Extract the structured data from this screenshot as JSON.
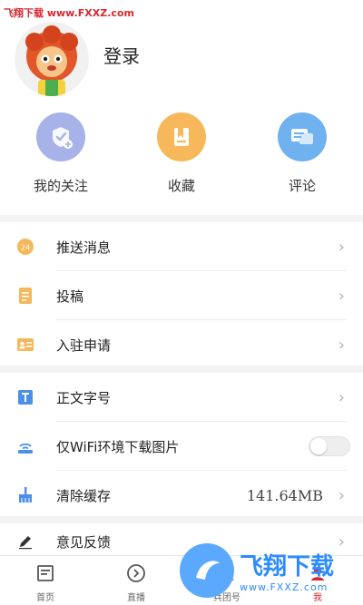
{
  "watermark_top": "飞翔下载 www.FXXZ.com",
  "profile": {
    "login_label": "登录"
  },
  "quick_actions": [
    {
      "label": "我的关注",
      "icon": "follow-icon",
      "color": "#a6b2e8"
    },
    {
      "label": "收藏",
      "icon": "bookmark-icon",
      "color": "#f6b85a"
    },
    {
      "label": "评论",
      "icon": "comment-icon",
      "color": "#6fb2ef"
    }
  ],
  "menu": {
    "push": {
      "label": "推送消息",
      "icon": "push-icon"
    },
    "submit": {
      "label": "投稿",
      "icon": "document-icon"
    },
    "join": {
      "label": "入驻申请",
      "icon": "id-card-icon"
    },
    "font": {
      "label": "正文字号",
      "icon": "text-size-icon"
    },
    "wifi": {
      "label": "仅WiFi环境下载图片",
      "icon": "wifi-icon",
      "enabled": false
    },
    "cache": {
      "label": "清除缓存",
      "value": "141.64MB",
      "icon": "broom-icon"
    },
    "feedback": {
      "label": "意见反馈",
      "icon": "pencil-icon"
    }
  },
  "tabbar": [
    {
      "label": "首页",
      "icon": "home-icon"
    },
    {
      "label": "直播",
      "icon": "live-icon"
    },
    {
      "label": "兵团号",
      "icon": "account-icon"
    },
    {
      "label": "我",
      "icon": "me-icon",
      "active": true
    }
  ],
  "brand_watermark": {
    "title": "飞翔下载",
    "url": "www.FXXZ.com"
  },
  "colors": {
    "accent": "#d8262f",
    "chevron": "#b4b4b4",
    "separator": "#f3f3f3"
  }
}
